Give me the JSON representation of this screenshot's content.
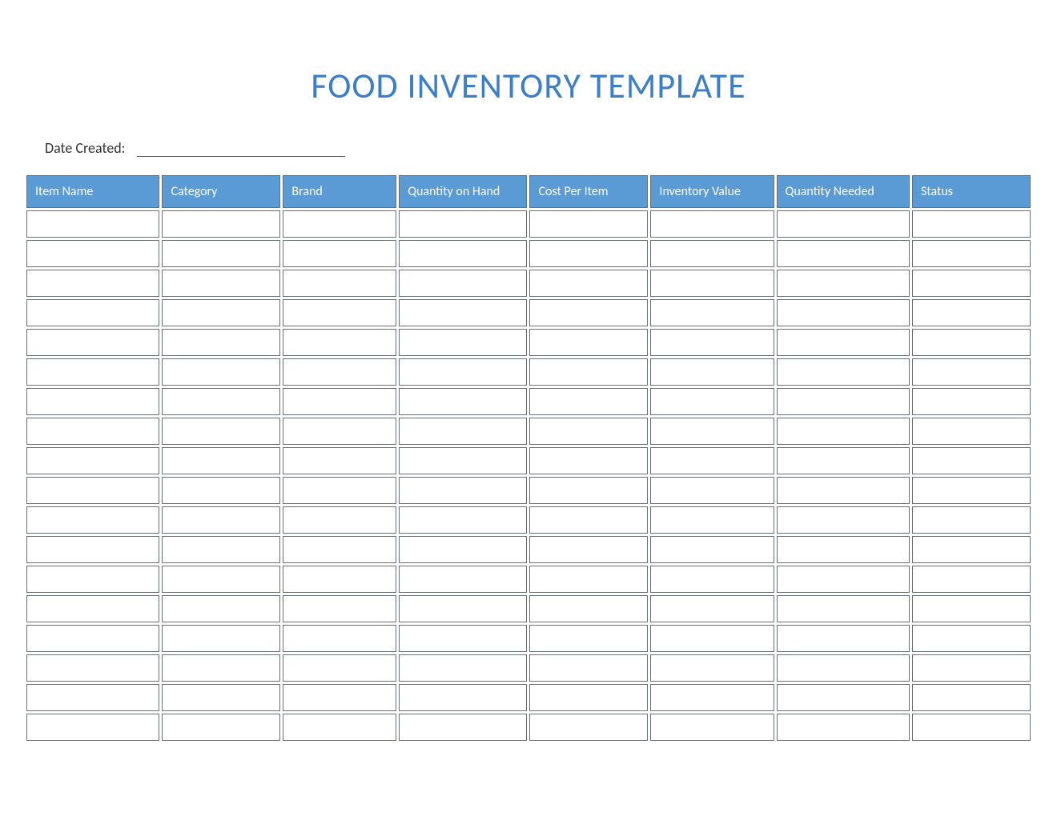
{
  "title": "FOOD INVENTORY TEMPLATE",
  "date_label": "Date Created:",
  "date_value": "",
  "columns": [
    "Item Name",
    "Category",
    "Brand",
    "Quantity on Hand",
    "Cost Per Item",
    "Inventory Value",
    "Quantity Needed",
    "Status"
  ],
  "rows": [
    [
      "",
      "",
      "",
      "",
      "",
      "",
      "",
      ""
    ],
    [
      "",
      "",
      "",
      "",
      "",
      "",
      "",
      ""
    ],
    [
      "",
      "",
      "",
      "",
      "",
      "",
      "",
      ""
    ],
    [
      "",
      "",
      "",
      "",
      "",
      "",
      "",
      ""
    ],
    [
      "",
      "",
      "",
      "",
      "",
      "",
      "",
      ""
    ],
    [
      "",
      "",
      "",
      "",
      "",
      "",
      "",
      ""
    ],
    [
      "",
      "",
      "",
      "",
      "",
      "",
      "",
      ""
    ],
    [
      "",
      "",
      "",
      "",
      "",
      "",
      "",
      ""
    ],
    [
      "",
      "",
      "",
      "",
      "",
      "",
      "",
      ""
    ],
    [
      "",
      "",
      "",
      "",
      "",
      "",
      "",
      ""
    ],
    [
      "",
      "",
      "",
      "",
      "",
      "",
      "",
      ""
    ],
    [
      "",
      "",
      "",
      "",
      "",
      "",
      "",
      ""
    ],
    [
      "",
      "",
      "",
      "",
      "",
      "",
      "",
      ""
    ],
    [
      "",
      "",
      "",
      "",
      "",
      "",
      "",
      ""
    ],
    [
      "",
      "",
      "",
      "",
      "",
      "",
      "",
      ""
    ],
    [
      "",
      "",
      "",
      "",
      "",
      "",
      "",
      ""
    ],
    [
      "",
      "",
      "",
      "",
      "",
      "",
      "",
      ""
    ],
    [
      "",
      "",
      "",
      "",
      "",
      "",
      "",
      ""
    ]
  ],
  "colors": {
    "accent": "#5b9bd5",
    "title": "#3d7ec9",
    "border": "#6a6f75"
  }
}
